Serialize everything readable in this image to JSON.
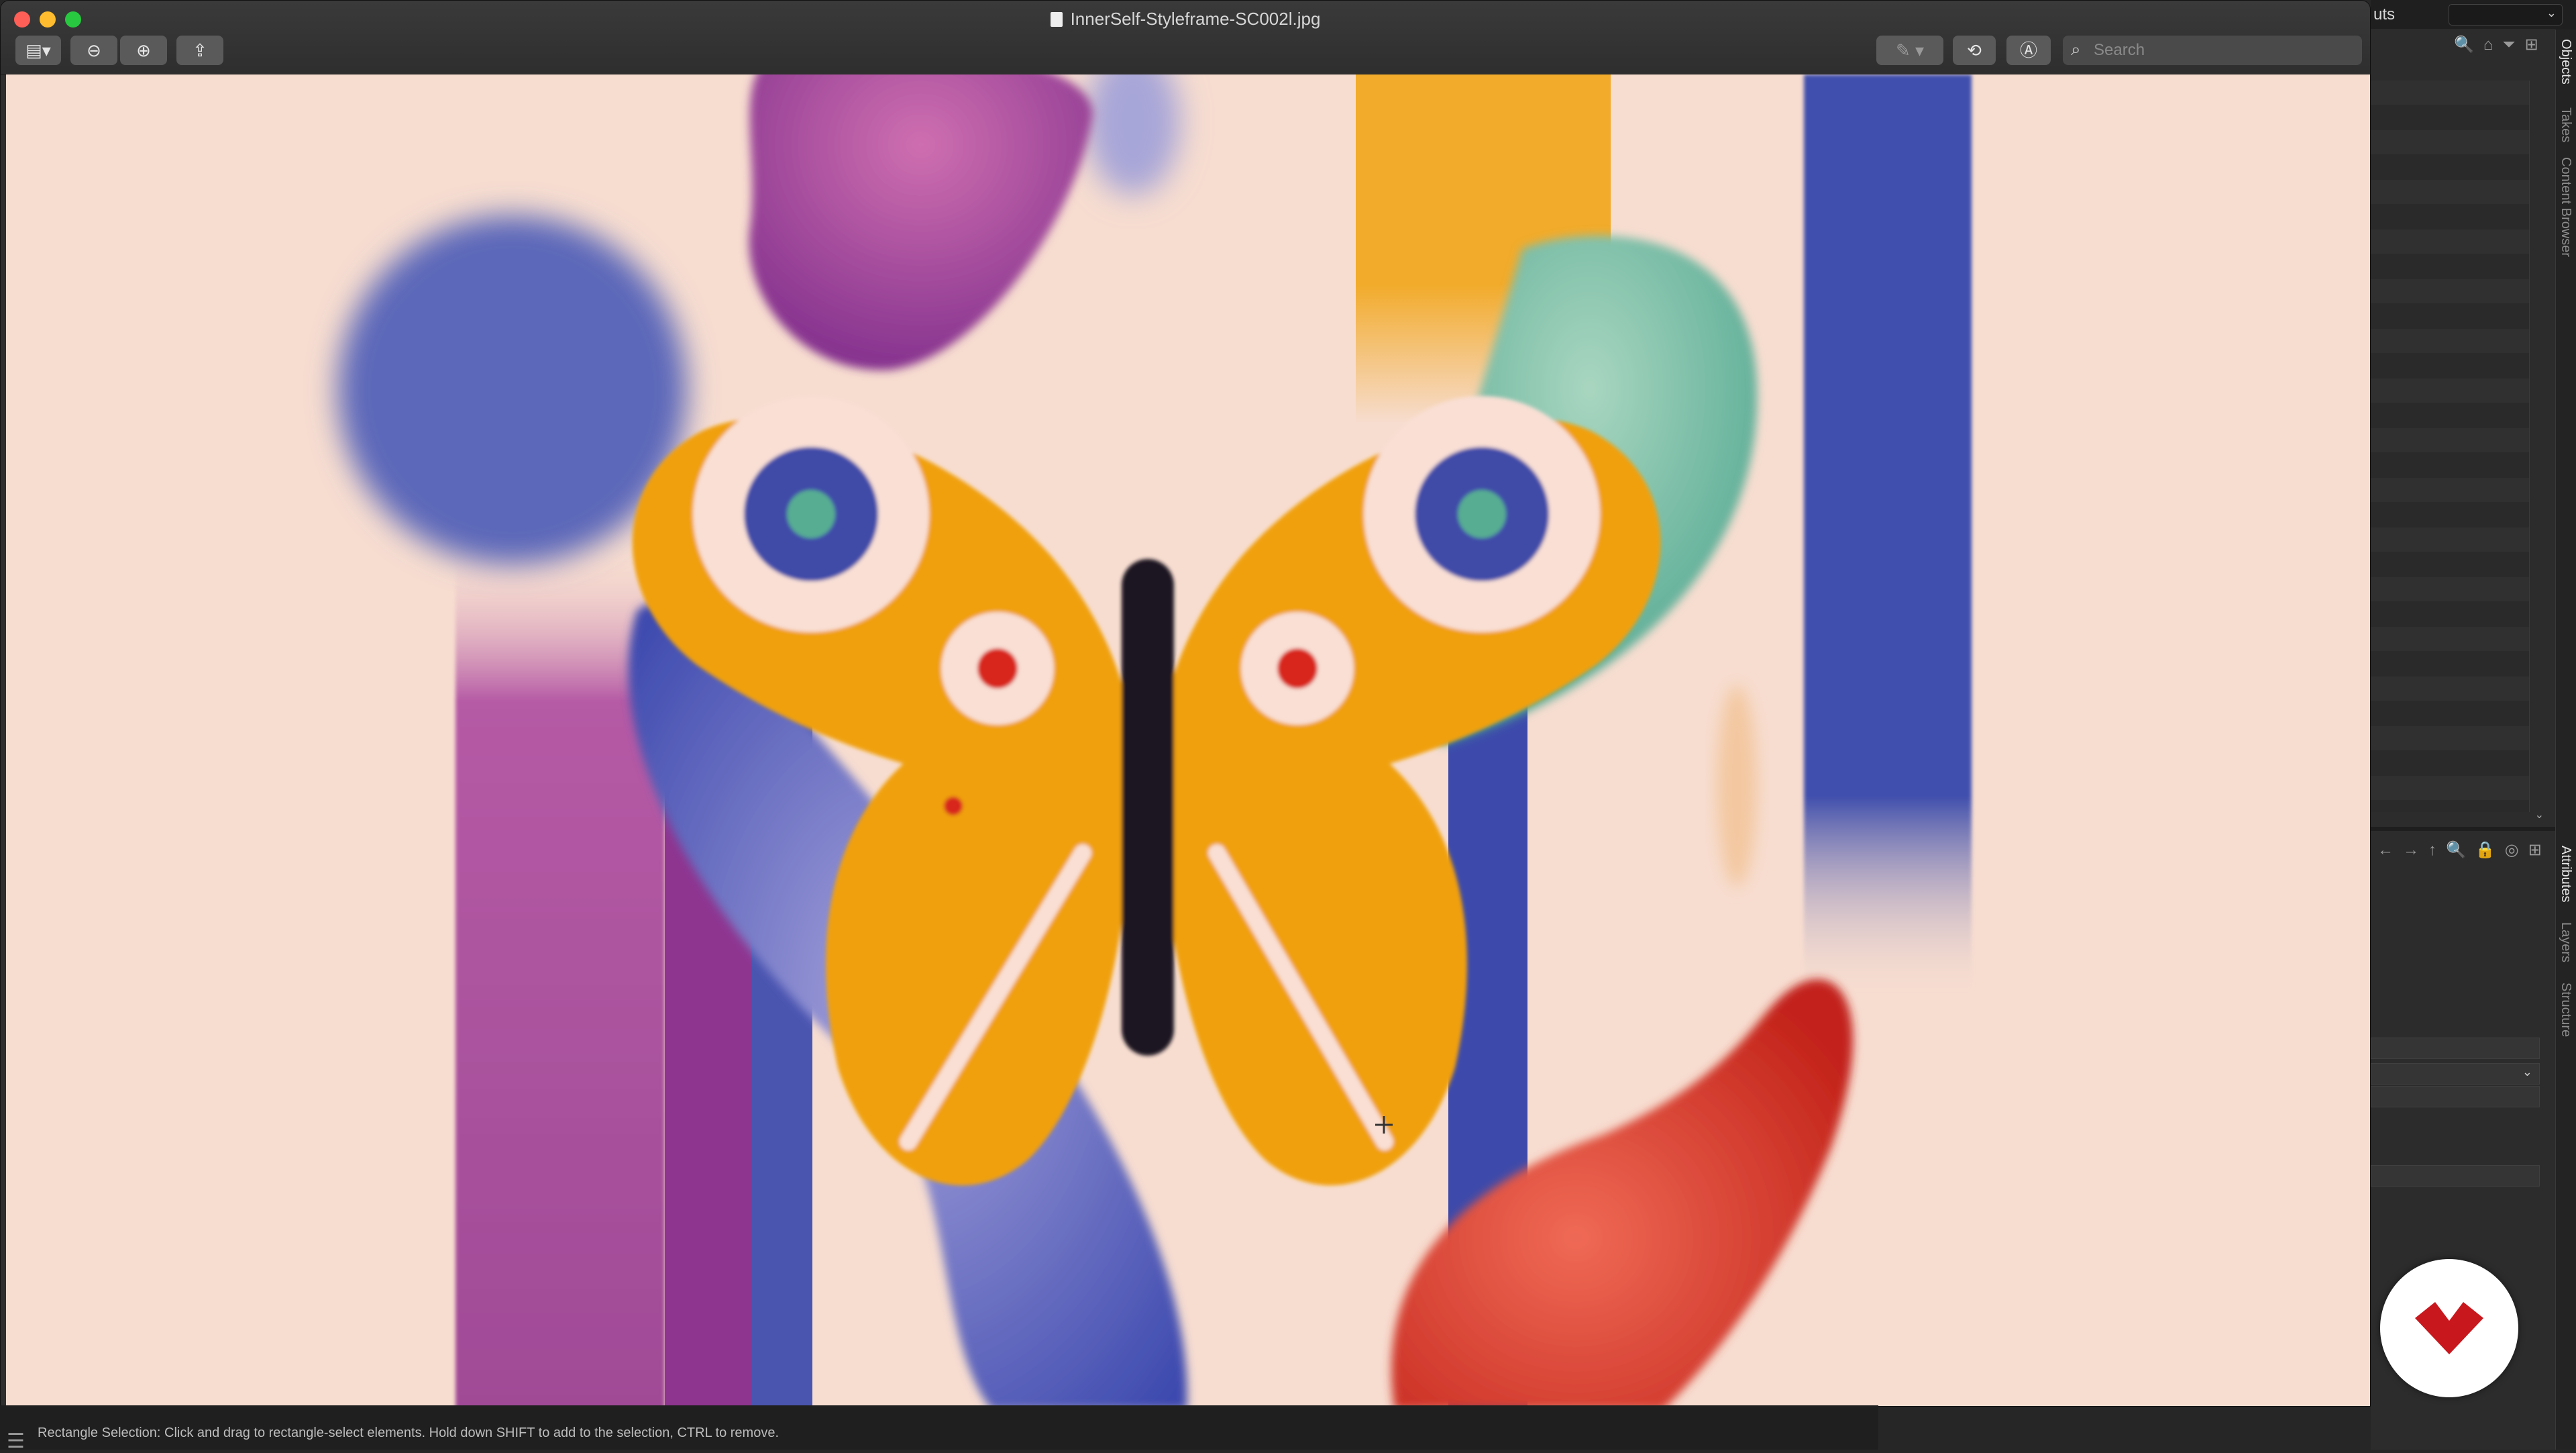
{
  "window": {
    "title": "InnerSelf-Styleframe-SC002l.jpg"
  },
  "toolbar": {
    "sidebar_icon": "▤▾",
    "zoom_out_icon": "⊖",
    "zoom_in_icon": "⊕",
    "share_icon": "⇪",
    "markup_icon": "✎ ▾",
    "rotate_icon": "⟲",
    "annotate_icon": "Ⓐ"
  },
  "search": {
    "icon": "⌕",
    "placeholder": "Search"
  },
  "side_panel": {
    "top_label": "uts",
    "dropdown_arrow": "⌄",
    "top_icons": [
      "🔍",
      "⌂",
      "⏷",
      "⊞"
    ],
    "bottom_icons": [
      "←",
      "→",
      "↑",
      "🔍",
      "🔒",
      "◎",
      "⊞"
    ],
    "rail_tabs": [
      {
        "label": "Objects",
        "active": true
      },
      {
        "label": "Takes",
        "active": false
      },
      {
        "label": "Content Browser",
        "active": false
      },
      {
        "label": "Attributes",
        "active": true
      },
      {
        "label": "Layers",
        "active": false
      },
      {
        "label": "Structure",
        "active": false
      }
    ]
  },
  "status": {
    "menu_icon": "☰",
    "text": "Rectangle Selection: Click and drag to rectangle-select elements. Hold down SHIFT to add to the selection, CTRL to remove."
  },
  "colors": {
    "canvas_bg": "#f7ddd0",
    "butterfly_orange": "#f0a00c",
    "blue": "#3f4ca8",
    "purple": "#9b3c95",
    "teal": "#4aa68f",
    "red": "#d0281c",
    "body_black": "#1a1420",
    "logo_red": "#c8171d"
  }
}
